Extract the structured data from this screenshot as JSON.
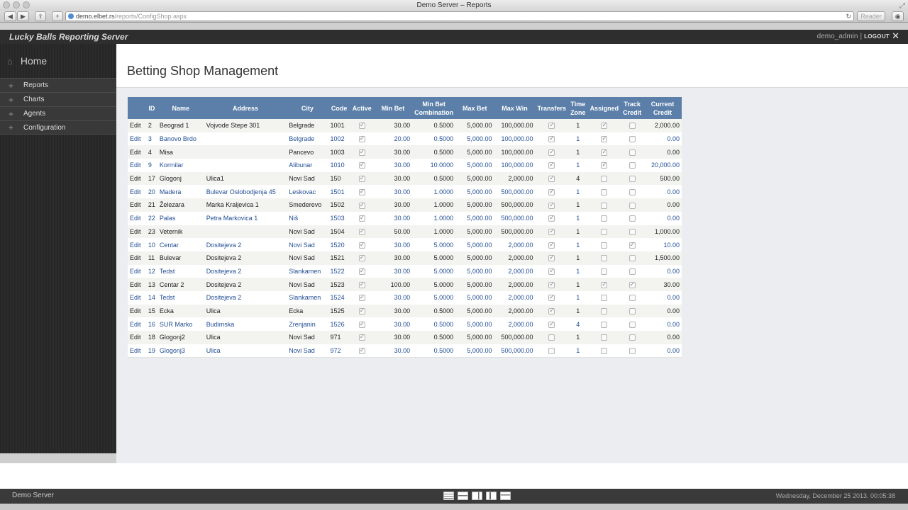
{
  "browser": {
    "window_title": "Demo Server – Reports",
    "url_host": "demo.elbet.rs",
    "url_path": "/reports/ConfigShop.aspx",
    "reader_label": "Reader"
  },
  "app": {
    "brand": "Lucky Balls Reporting Server",
    "username": "demo_admin",
    "separator": "|",
    "logout_label": "LOGOUT"
  },
  "sidebar": {
    "home_label": "Home",
    "items": [
      {
        "label": "Reports"
      },
      {
        "label": "Charts"
      },
      {
        "label": "Agents"
      },
      {
        "label": "Configuration"
      }
    ]
  },
  "page": {
    "title": "Betting Shop Management"
  },
  "table": {
    "columns": [
      "",
      "ID",
      "Name",
      "Address",
      "City",
      "Code",
      "Active",
      "Min Bet",
      "Min Bet Combination",
      "Max Bet",
      "Max Win",
      "Transfers",
      "Time Zone",
      "Assigned",
      "Track Credit",
      "Current Credit"
    ],
    "rows": [
      {
        "edit": "Edit",
        "id": "2",
        "name": "Beograd 1",
        "address": "Vojvode Stepe 301",
        "city": "Belgrade",
        "code": "1001",
        "active": true,
        "min_bet": "30.00",
        "min_bet_comb": "0.5000",
        "max_bet": "5,000.00",
        "max_win": "100,000.00",
        "transfers": true,
        "time_zone": "1",
        "assigned": true,
        "track_credit": false,
        "current_credit": "2,000.00"
      },
      {
        "edit": "Edit",
        "id": "3",
        "name": "Banovo Brdo",
        "address": "",
        "city": "Belgrade",
        "code": "1002",
        "active": true,
        "min_bet": "20.00",
        "min_bet_comb": "0.5000",
        "max_bet": "5,000.00",
        "max_win": "100,000.00",
        "transfers": true,
        "time_zone": "1",
        "assigned": true,
        "track_credit": false,
        "current_credit": "0.00"
      },
      {
        "edit": "Edit",
        "id": "4",
        "name": "Misa",
        "address": "",
        "city": "Pancevo",
        "code": "1003",
        "active": true,
        "min_bet": "30.00",
        "min_bet_comb": "0.5000",
        "max_bet": "5,000.00",
        "max_win": "100,000.00",
        "transfers": true,
        "time_zone": "1",
        "assigned": true,
        "track_credit": false,
        "current_credit": "0.00"
      },
      {
        "edit": "Edit",
        "id": "9",
        "name": "Kormilar",
        "address": "",
        "city": "Alibunar",
        "code": "1010",
        "active": true,
        "min_bet": "30.00",
        "min_bet_comb": "10.0000",
        "max_bet": "5,000.00",
        "max_win": "100,000.00",
        "transfers": true,
        "time_zone": "1",
        "assigned": true,
        "track_credit": false,
        "current_credit": "20,000.00"
      },
      {
        "edit": "Edit",
        "id": "17",
        "name": "Glogonj",
        "address": "Ulica1",
        "city": "Novi Sad",
        "code": "150",
        "active": true,
        "min_bet": "30.00",
        "min_bet_comb": "0.5000",
        "max_bet": "5,000.00",
        "max_win": "2,000.00",
        "transfers": true,
        "time_zone": "4",
        "assigned": false,
        "track_credit": false,
        "current_credit": "500.00"
      },
      {
        "edit": "Edit",
        "id": "20",
        "name": "Madera",
        "address": "Bulevar Oslobodjenja 45",
        "city": "Leskovac",
        "code": "1501",
        "active": true,
        "min_bet": "30.00",
        "min_bet_comb": "1.0000",
        "max_bet": "5,000.00",
        "max_win": "500,000.00",
        "transfers": true,
        "time_zone": "1",
        "assigned": false,
        "track_credit": false,
        "current_credit": "0.00"
      },
      {
        "edit": "Edit",
        "id": "21",
        "name": "Železara",
        "address": "Marka Kraljevica 1",
        "city": "Smederevo",
        "code": "1502",
        "active": true,
        "min_bet": "30.00",
        "min_bet_comb": "1.0000",
        "max_bet": "5,000.00",
        "max_win": "500,000.00",
        "transfers": true,
        "time_zone": "1",
        "assigned": false,
        "track_credit": false,
        "current_credit": "0.00"
      },
      {
        "edit": "Edit",
        "id": "22",
        "name": "Palas",
        "address": "Petra Markovica 1",
        "city": "Niš",
        "code": "1503",
        "active": true,
        "min_bet": "30.00",
        "min_bet_comb": "1.0000",
        "max_bet": "5,000.00",
        "max_win": "500,000.00",
        "transfers": true,
        "time_zone": "1",
        "assigned": false,
        "track_credit": false,
        "current_credit": "0.00"
      },
      {
        "edit": "Edit",
        "id": "23",
        "name": "Veternik",
        "address": "",
        "city": "Novi Sad",
        "code": "1504",
        "active": true,
        "min_bet": "50.00",
        "min_bet_comb": "1.0000",
        "max_bet": "5,000.00",
        "max_win": "500,000.00",
        "transfers": true,
        "time_zone": "1",
        "assigned": false,
        "track_credit": false,
        "current_credit": "1,000.00"
      },
      {
        "edit": "Edit",
        "id": "10",
        "name": "Centar",
        "address": "Dositejeva 2",
        "city": "Novi Sad",
        "code": "1520",
        "active": true,
        "min_bet": "30.00",
        "min_bet_comb": "5.0000",
        "max_bet": "5,000.00",
        "max_win": "2,000.00",
        "transfers": true,
        "time_zone": "1",
        "assigned": false,
        "track_credit": true,
        "current_credit": "10.00"
      },
      {
        "edit": "Edit",
        "id": "11",
        "name": "Bulevar",
        "address": "Dositejeva 2",
        "city": "Novi Sad",
        "code": "1521",
        "active": true,
        "min_bet": "30.00",
        "min_bet_comb": "5.0000",
        "max_bet": "5,000.00",
        "max_win": "2,000.00",
        "transfers": true,
        "time_zone": "1",
        "assigned": false,
        "track_credit": false,
        "current_credit": "1,500.00"
      },
      {
        "edit": "Edit",
        "id": "12",
        "name": "Tedst",
        "address": "Dositejeva 2",
        "city": "Slankamen",
        "code": "1522",
        "active": true,
        "min_bet": "30.00",
        "min_bet_comb": "5.0000",
        "max_bet": "5,000.00",
        "max_win": "2,000.00",
        "transfers": true,
        "time_zone": "1",
        "assigned": false,
        "track_credit": false,
        "current_credit": "0.00"
      },
      {
        "edit": "Edit",
        "id": "13",
        "name": "Centar 2",
        "address": "Dositejeva 2",
        "city": "Novi Sad",
        "code": "1523",
        "active": true,
        "min_bet": "100.00",
        "min_bet_comb": "5.0000",
        "max_bet": "5,000.00",
        "max_win": "2,000.00",
        "transfers": true,
        "time_zone": "1",
        "assigned": true,
        "track_credit": true,
        "current_credit": "30.00"
      },
      {
        "edit": "Edit",
        "id": "14",
        "name": "Tedst",
        "address": "Dositejeva 2",
        "city": "Slankamen",
        "code": "1524",
        "active": true,
        "min_bet": "30.00",
        "min_bet_comb": "5.0000",
        "max_bet": "5,000.00",
        "max_win": "2,000.00",
        "transfers": true,
        "time_zone": "1",
        "assigned": false,
        "track_credit": false,
        "current_credit": "0.00"
      },
      {
        "edit": "Edit",
        "id": "15",
        "name": "Ecka",
        "address": "Ulica",
        "city": "Ecka",
        "code": "1525",
        "active": true,
        "min_bet": "30.00",
        "min_bet_comb": "0.5000",
        "max_bet": "5,000.00",
        "max_win": "2,000.00",
        "transfers": true,
        "time_zone": "1",
        "assigned": false,
        "track_credit": false,
        "current_credit": "0.00"
      },
      {
        "edit": "Edit",
        "id": "16",
        "name": "SUR Marko",
        "address": "Budimska",
        "city": "Zrenjanin",
        "code": "1526",
        "active": true,
        "min_bet": "30.00",
        "min_bet_comb": "0.5000",
        "max_bet": "5,000.00",
        "max_win": "2,000.00",
        "transfers": true,
        "time_zone": "4",
        "assigned": false,
        "track_credit": false,
        "current_credit": "0.00"
      },
      {
        "edit": "Edit",
        "id": "18",
        "name": "Glogonj2",
        "address": "Ulica",
        "city": "Novi Sad",
        "code": "971",
        "active": true,
        "min_bet": "30.00",
        "min_bet_comb": "0.5000",
        "max_bet": "5,000.00",
        "max_win": "500,000.00",
        "transfers": false,
        "time_zone": "1",
        "assigned": false,
        "track_credit": false,
        "current_credit": "0.00"
      },
      {
        "edit": "Edit",
        "id": "19",
        "name": "Glogonj3",
        "address": "Ulica",
        "city": "Novi Sad",
        "code": "972",
        "active": true,
        "min_bet": "30.00",
        "min_bet_comb": "0.5000",
        "max_bet": "5,000.00",
        "max_win": "500,000.00",
        "transfers": false,
        "time_zone": "1",
        "assigned": false,
        "track_credit": false,
        "current_credit": "0.00"
      }
    ]
  },
  "footer": {
    "server_name": "Demo Server",
    "datetime": "Wednesday, December 25 2013. 00:05:38",
    "layout_icons": [
      "rows-layout-icon",
      "split-horizontal-icon",
      "split-right-icon",
      "split-left-icon",
      "top-bar-icon"
    ]
  },
  "colors": {
    "header_bg": "#5b7fa9",
    "link_blue": "#224e94",
    "sidebar_bg": "#2a2a2a",
    "appbar_bg": "#2e2e2e"
  }
}
